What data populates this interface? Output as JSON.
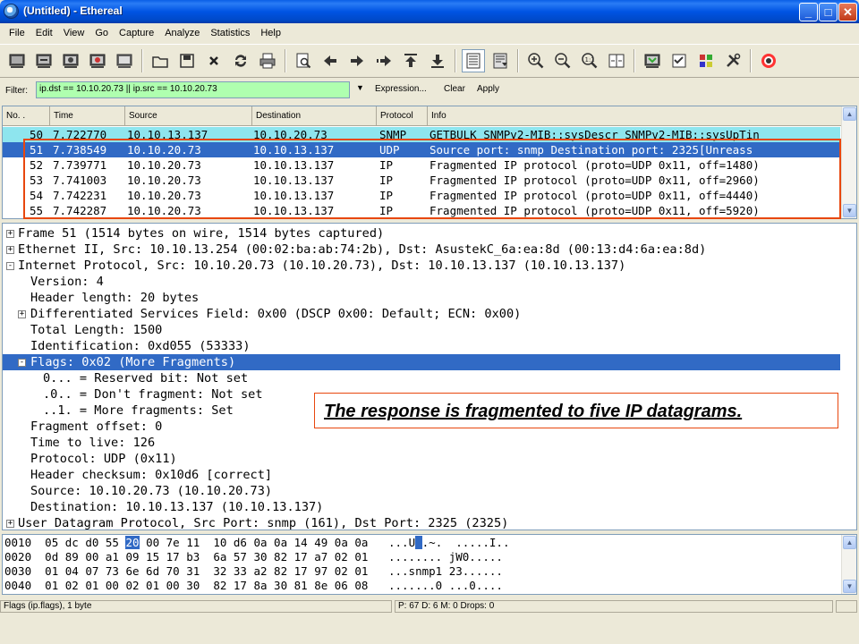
{
  "window": {
    "title": "(Untitled) - Ethereal",
    "buttons": {
      "minimize": "_",
      "maximize": "□",
      "close": "✕"
    }
  },
  "menu": [
    "File",
    "Edit",
    "View",
    "Go",
    "Capture",
    "Analyze",
    "Statistics",
    "Help"
  ],
  "toolbar_icons": [
    "interfaces-icon",
    "capture-options-icon",
    "start-capture-icon",
    "stop-capture-icon",
    "restart-capture-icon",
    "open-icon",
    "save-icon",
    "close-file-icon",
    "reload-icon",
    "print-icon",
    "find-icon",
    "go-back-icon",
    "go-forward-icon",
    "go-to-packet-icon",
    "go-first-icon",
    "go-last-icon",
    "colorize-icon",
    "auto-scroll-icon",
    "zoom-in-icon",
    "zoom-out-icon",
    "normal-size-icon",
    "resize-columns-icon",
    "capture-filters-icon",
    "display-filters-icon",
    "coloring-rules-icon",
    "preferences-icon",
    "help-icon"
  ],
  "filter": {
    "label": "Filter:",
    "value": "ip.dst == 10.10.20.73 || ip.src == 10.10.20.73",
    "expression": "Expression...",
    "clear": "Clear",
    "apply": "Apply"
  },
  "packet_list": {
    "columns": [
      "No. .",
      "Time",
      "Source",
      "Destination",
      "Protocol",
      "Info"
    ],
    "rows": [
      {
        "no": "50",
        "time": "7.722770",
        "src": "10.10.13.137",
        "dst": "10.10.20.73",
        "proto": "SNMP",
        "info": "GETBULK SNMPv2-MIB::sysDescr SNMPv2-MIB::sysUpTin"
      },
      {
        "no": "51",
        "time": "7.738549",
        "src": "10.10.20.73",
        "dst": "10.10.13.137",
        "proto": "UDP",
        "info": "Source port: snmp  Destination port: 2325[Unreass"
      },
      {
        "no": "52",
        "time": "7.739771",
        "src": "10.10.20.73",
        "dst": "10.10.13.137",
        "proto": "IP",
        "info": "Fragmented IP protocol (proto=UDP 0x11, off=1480)"
      },
      {
        "no": "53",
        "time": "7.741003",
        "src": "10.10.20.73",
        "dst": "10.10.13.137",
        "proto": "IP",
        "info": "Fragmented IP protocol (proto=UDP 0x11, off=2960)"
      },
      {
        "no": "54",
        "time": "7.742231",
        "src": "10.10.20.73",
        "dst": "10.10.13.137",
        "proto": "IP",
        "info": "Fragmented IP protocol (proto=UDP 0x11, off=4440)"
      },
      {
        "no": "55",
        "time": "7.742287",
        "src": "10.10.20.73",
        "dst": "10.10.13.137",
        "proto": "IP",
        "info": "Fragmented IP protocol (proto=UDP 0x11, off=5920)"
      }
    ]
  },
  "details": [
    {
      "indent": 0,
      "exp": "+",
      "text": "Frame 51 (1514 bytes on wire, 1514 bytes captured)"
    },
    {
      "indent": 0,
      "exp": "+",
      "text": "Ethernet II, Src: 10.10.13.254 (00:02:ba:ab:74:2b), Dst: AsustekC_6a:ea:8d (00:13:d4:6a:ea:8d)"
    },
    {
      "indent": 0,
      "exp": "-",
      "text": "Internet Protocol, Src: 10.10.20.73 (10.10.20.73), Dst: 10.10.13.137 (10.10.13.137)"
    },
    {
      "indent": 1,
      "exp": "",
      "text": "Version: 4"
    },
    {
      "indent": 1,
      "exp": "",
      "text": "Header length: 20 bytes"
    },
    {
      "indent": 1,
      "exp": "+",
      "text": "Differentiated Services Field: 0x00 (DSCP 0x00: Default; ECN: 0x00)"
    },
    {
      "indent": 1,
      "exp": "",
      "text": "Total Length: 1500"
    },
    {
      "indent": 1,
      "exp": "",
      "text": "Identification: 0xd055 (53333)"
    },
    {
      "indent": 1,
      "exp": "-",
      "text": "Flags: 0x02 (More Fragments)"
    },
    {
      "indent": 2,
      "exp": "",
      "text": "0... = Reserved bit: Not set"
    },
    {
      "indent": 2,
      "exp": "",
      "text": ".0.. = Don't fragment: Not set"
    },
    {
      "indent": 2,
      "exp": "",
      "text": "..1. = More fragments: Set"
    },
    {
      "indent": 1,
      "exp": "",
      "text": "Fragment offset: 0"
    },
    {
      "indent": 1,
      "exp": "",
      "text": "Time to live: 126"
    },
    {
      "indent": 1,
      "exp": "",
      "text": "Protocol: UDP (0x11)"
    },
    {
      "indent": 1,
      "exp": "",
      "text": "Header checksum: 0x10d6 [correct]"
    },
    {
      "indent": 1,
      "exp": "",
      "text": "Source: 10.10.20.73 (10.10.20.73)"
    },
    {
      "indent": 1,
      "exp": "",
      "text": "Destination: 10.10.13.137 (10.10.13.137)"
    },
    {
      "indent": 0,
      "exp": "+",
      "text": "User Datagram Protocol, Src Port: snmp (161), Dst Port: 2325 (2325)"
    }
  ],
  "callout": "The response is fragmented to five IP datagrams.",
  "hex": [
    {
      "off": "0010",
      "a": "05 dc d0 55 ",
      "hl": "20",
      "b": " 00 7e 11  10 d6 0a 0a 14 49 0a 0a",
      "ascii_a": "...U",
      "ascii_hl": " ",
      "ascii_b": ".~.  .....I.."
    },
    {
      "off": "0020",
      "a": "0d 89 00 a1 09 15 17 b3  6a 57 30 82 17 a7 02 01",
      "hl": "",
      "b": "",
      "ascii_a": "........ jW0.....",
      "ascii_hl": "",
      "ascii_b": ""
    },
    {
      "off": "0030",
      "a": "01 04 07 73 6e 6d 70 31  32 33 a2 82 17 97 02 01",
      "hl": "",
      "b": "",
      "ascii_a": "...snmp1 23......",
      "ascii_hl": "",
      "ascii_b": ""
    },
    {
      "off": "0040",
      "a": "01 02 01 00 02 01 00 30  82 17 8a 30 81 8e 06 08",
      "hl": "",
      "b": "",
      "ascii_a": ".......0 ...0....",
      "ascii_hl": "",
      "ascii_b": ""
    }
  ],
  "status": {
    "left": "Flags (ip.flags), 1 byte",
    "right": "P: 67 D: 6 M: 0 Drops: 0"
  }
}
